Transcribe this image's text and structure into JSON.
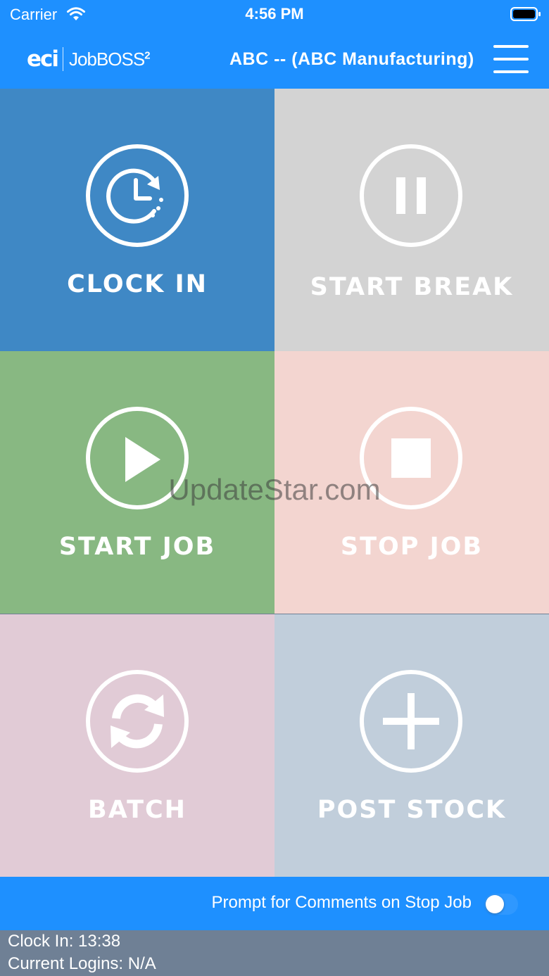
{
  "status_bar": {
    "carrier": "Carrier",
    "time": "4:56 PM"
  },
  "header": {
    "logo_brand": "eci",
    "logo_product": "JobBOSS",
    "logo_superscript": "2",
    "title": "ABC -- (ABC Manufacturing)"
  },
  "tiles": [
    {
      "label": "CLOCK IN",
      "color": "#3f88c5",
      "icon": "clock-in-icon"
    },
    {
      "label": "START BREAK",
      "color": "#d3d3d3",
      "icon": "pause-icon"
    },
    {
      "label": "START JOB",
      "color": "#88b882",
      "icon": "play-icon"
    },
    {
      "label": "STOP JOB",
      "color": "#f3d5d0",
      "icon": "stop-icon"
    },
    {
      "label": "BATCH",
      "color": "#e1cbd6",
      "icon": "refresh-icon"
    },
    {
      "label": "POST STOCK",
      "color": "#c1cedb",
      "icon": "plus-icon"
    }
  ],
  "footer": {
    "prompt_label": "Prompt for Comments on Stop Job",
    "prompt_enabled": false
  },
  "info": {
    "clock_in": "Clock In: 13:38",
    "current_logins": "Current Logins: N/A"
  },
  "watermark": "UpdateStar.com",
  "colors": {
    "accent": "#1e90ff",
    "info_bg": "#6f8095"
  }
}
